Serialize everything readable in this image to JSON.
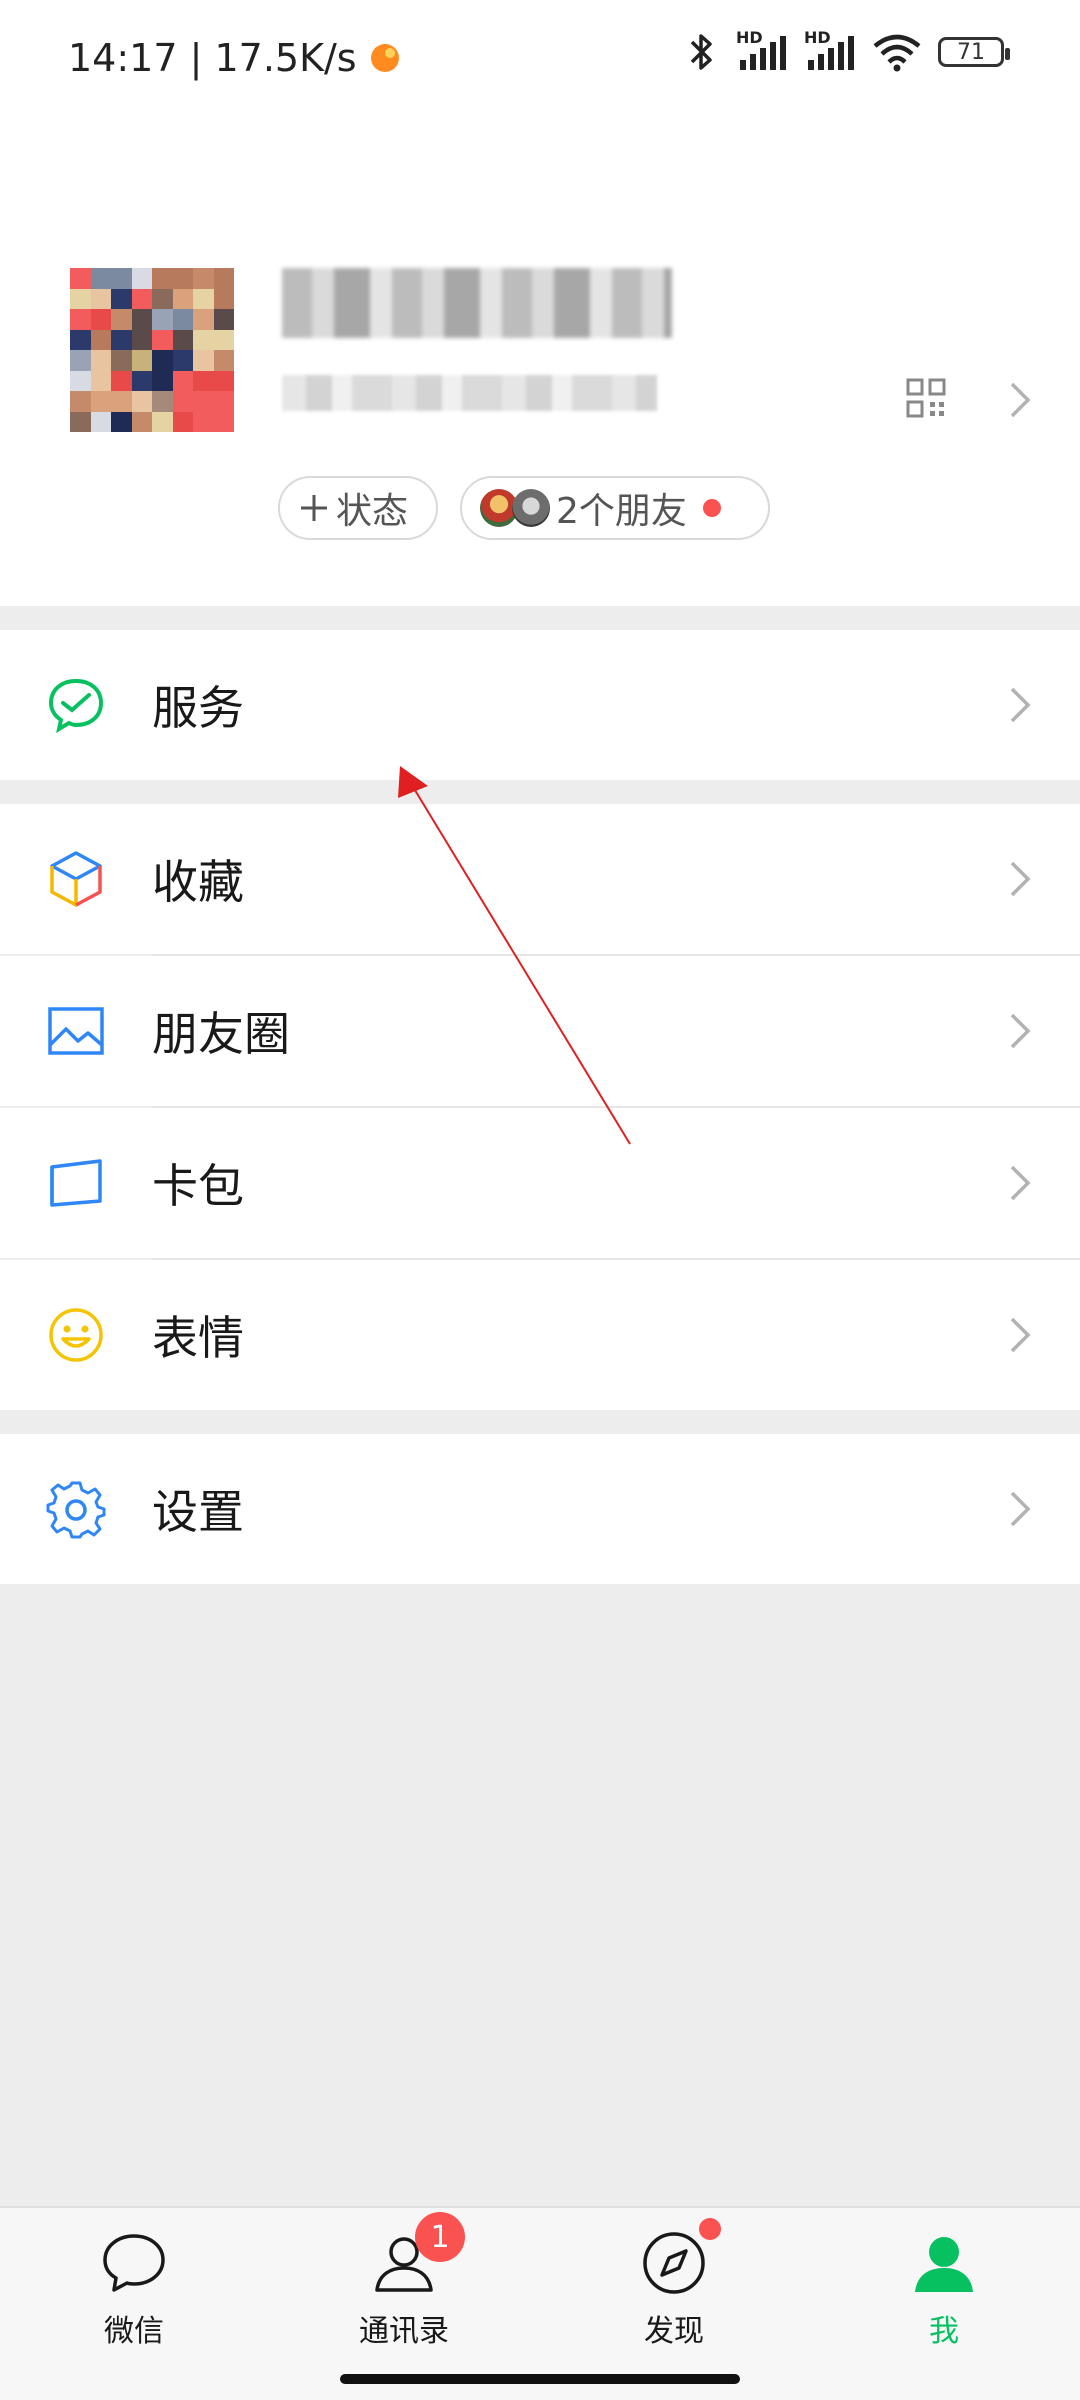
{
  "status_bar": {
    "time_speed": "14:17 | 17.5K/s",
    "battery": "71",
    "network_tag_1": "HD",
    "network_tag_2": "HD"
  },
  "profile": {
    "status_button": "状态",
    "friends_text": "2个朋友"
  },
  "menu": {
    "services": "服务",
    "favorites": "收藏",
    "moments": "朋友圈",
    "card_wallet": "卡包",
    "stickers": "表情",
    "settings": "设置"
  },
  "tabbar": {
    "chats": "微信",
    "contacts": "通讯录",
    "contacts_badge": "1",
    "discover": "发现",
    "me": "我"
  },
  "colors": {
    "accent": "#07c160",
    "badge": "#fa5151",
    "background": "#ededed"
  }
}
